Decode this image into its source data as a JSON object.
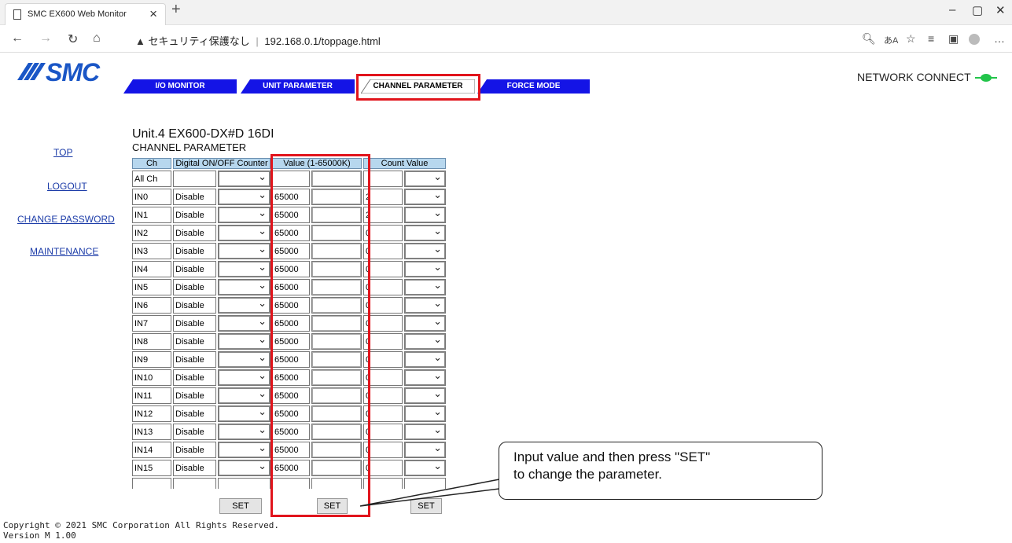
{
  "browser": {
    "tab_title": "SMC EX600 Web Monitor",
    "new_tab": "+",
    "security_label": "セキュリティ保護なし",
    "url": "192.168.0.1/toppage.html"
  },
  "brand": {
    "logo_text": "SMC"
  },
  "nav_tabs": [
    "I/O MONITOR",
    "UNIT PARAMETER",
    "CHANNEL PARAMETER",
    "FORCE MODE"
  ],
  "active_tab": "CHANNEL PARAMETER",
  "network": {
    "label": "NETWORK CONNECT",
    "status_color": "#22c44a"
  },
  "sidebar": [
    "TOP",
    "LOGOUT",
    "CHANGE PASSWORD",
    "MAINTENANCE"
  ],
  "unit_title": "Unit.4 EX600-DX#D 16DI",
  "section_title": "CHANNEL PARAMETER",
  "table": {
    "headers": [
      "Ch",
      "Digital ON/OFF Counter",
      "Value (1-65000K)",
      "Count Value"
    ],
    "all_row_label": "All Ch",
    "rows": [
      {
        "ch": "IN0",
        "counter": "Disable",
        "value": "65000",
        "count": "2"
      },
      {
        "ch": "IN1",
        "counter": "Disable",
        "value": "65000",
        "count": "2"
      },
      {
        "ch": "IN2",
        "counter": "Disable",
        "value": "65000",
        "count": "0"
      },
      {
        "ch": "IN3",
        "counter": "Disable",
        "value": "65000",
        "count": "0"
      },
      {
        "ch": "IN4",
        "counter": "Disable",
        "value": "65000",
        "count": "0"
      },
      {
        "ch": "IN5",
        "counter": "Disable",
        "value": "65000",
        "count": "0"
      },
      {
        "ch": "IN6",
        "counter": "Disable",
        "value": "65000",
        "count": "0"
      },
      {
        "ch": "IN7",
        "counter": "Disable",
        "value": "65000",
        "count": "0"
      },
      {
        "ch": "IN8",
        "counter": "Disable",
        "value": "65000",
        "count": "0"
      },
      {
        "ch": "IN9",
        "counter": "Disable",
        "value": "65000",
        "count": "0"
      },
      {
        "ch": "IN10",
        "counter": "Disable",
        "value": "65000",
        "count": "0"
      },
      {
        "ch": "IN11",
        "counter": "Disable",
        "value": "65000",
        "count": "0"
      },
      {
        "ch": "IN12",
        "counter": "Disable",
        "value": "65000",
        "count": "0"
      },
      {
        "ch": "IN13",
        "counter": "Disable",
        "value": "65000",
        "count": "0"
      },
      {
        "ch": "IN14",
        "counter": "Disable",
        "value": "65000",
        "count": "0"
      },
      {
        "ch": "IN15",
        "counter": "Disable",
        "value": "65000",
        "count": "0"
      }
    ],
    "set_label": "SET"
  },
  "callout": {
    "line1": "Input value and then press \"SET\"",
    "line2": "to change the parameter."
  },
  "footer": {
    "copyright": "Copyright © 2021 SMC Corporation All Rights Reserved.",
    "version": "Version M 1.00"
  },
  "colors": {
    "highlight": "#e1141c",
    "nav_blue": "#1414e6",
    "header_bg": "#b7d7ee",
    "brand_blue": "#1a56c6"
  }
}
